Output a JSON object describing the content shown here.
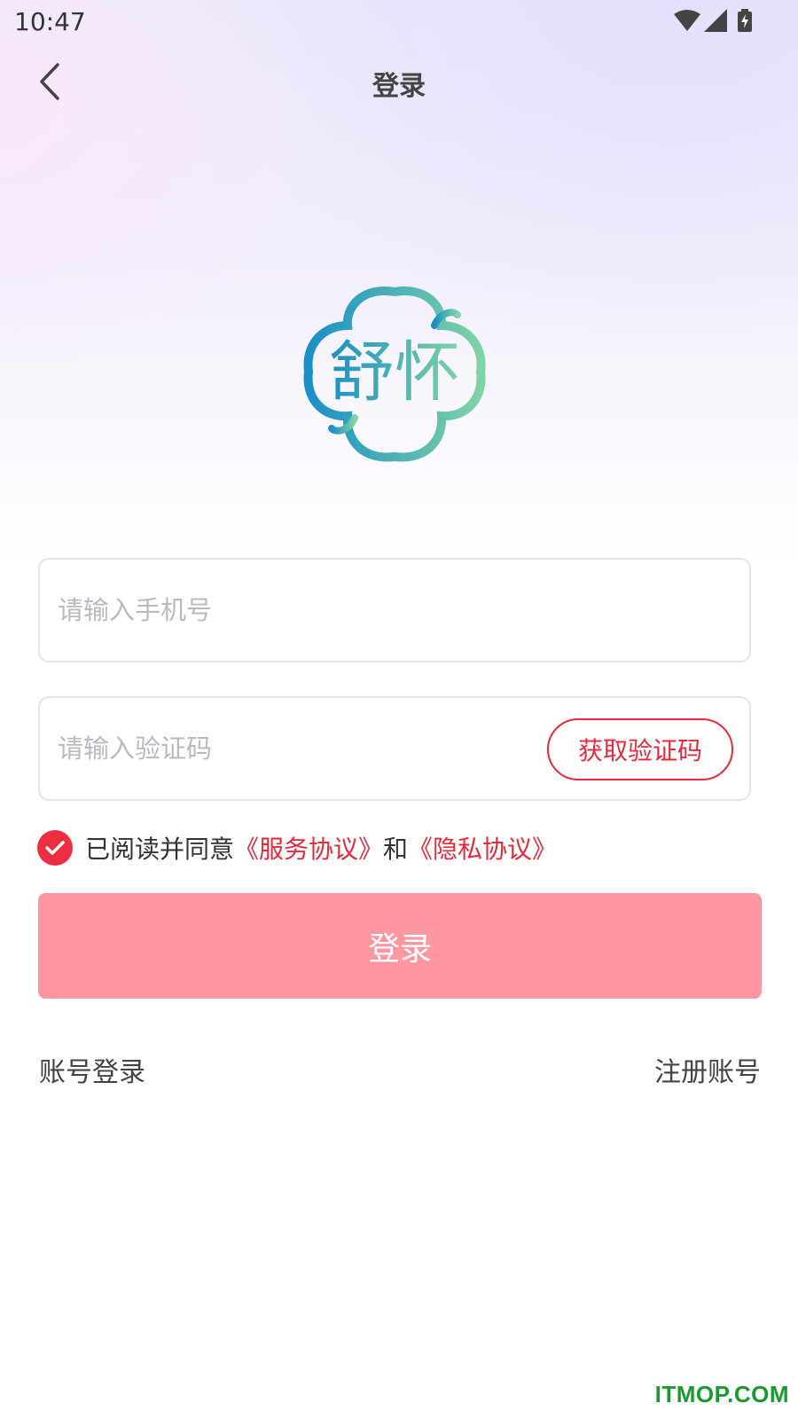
{
  "status_bar": {
    "time": "10:47",
    "icons": [
      "wifi-icon",
      "signal-icon",
      "battery-charging-icon"
    ]
  },
  "nav": {
    "back_icon": "chevron-left-icon",
    "title": "登录"
  },
  "logo": {
    "text": "舒怀",
    "colors": {
      "start": "#1a8fc4",
      "end": "#7fd3a6"
    }
  },
  "form": {
    "phone": {
      "placeholder": "请输入手机号",
      "value": ""
    },
    "code": {
      "placeholder": "请输入验证码",
      "value": ""
    },
    "get_code_label": "获取验证码"
  },
  "agreement": {
    "checked": true,
    "prefix": "已阅读并同意",
    "service_link": "《服务协议》",
    "conjunction": "和",
    "privacy_link": "《隐私协议》"
  },
  "login_button": {
    "label": "登录"
  },
  "links": {
    "account_login": "账号登录",
    "register": "注册账号"
  },
  "watermark": "ITMOP.COM",
  "colors": {
    "accent": "#e8293b",
    "login_button_bg": "#ff97a0",
    "placeholder": "#b9b9c3"
  }
}
